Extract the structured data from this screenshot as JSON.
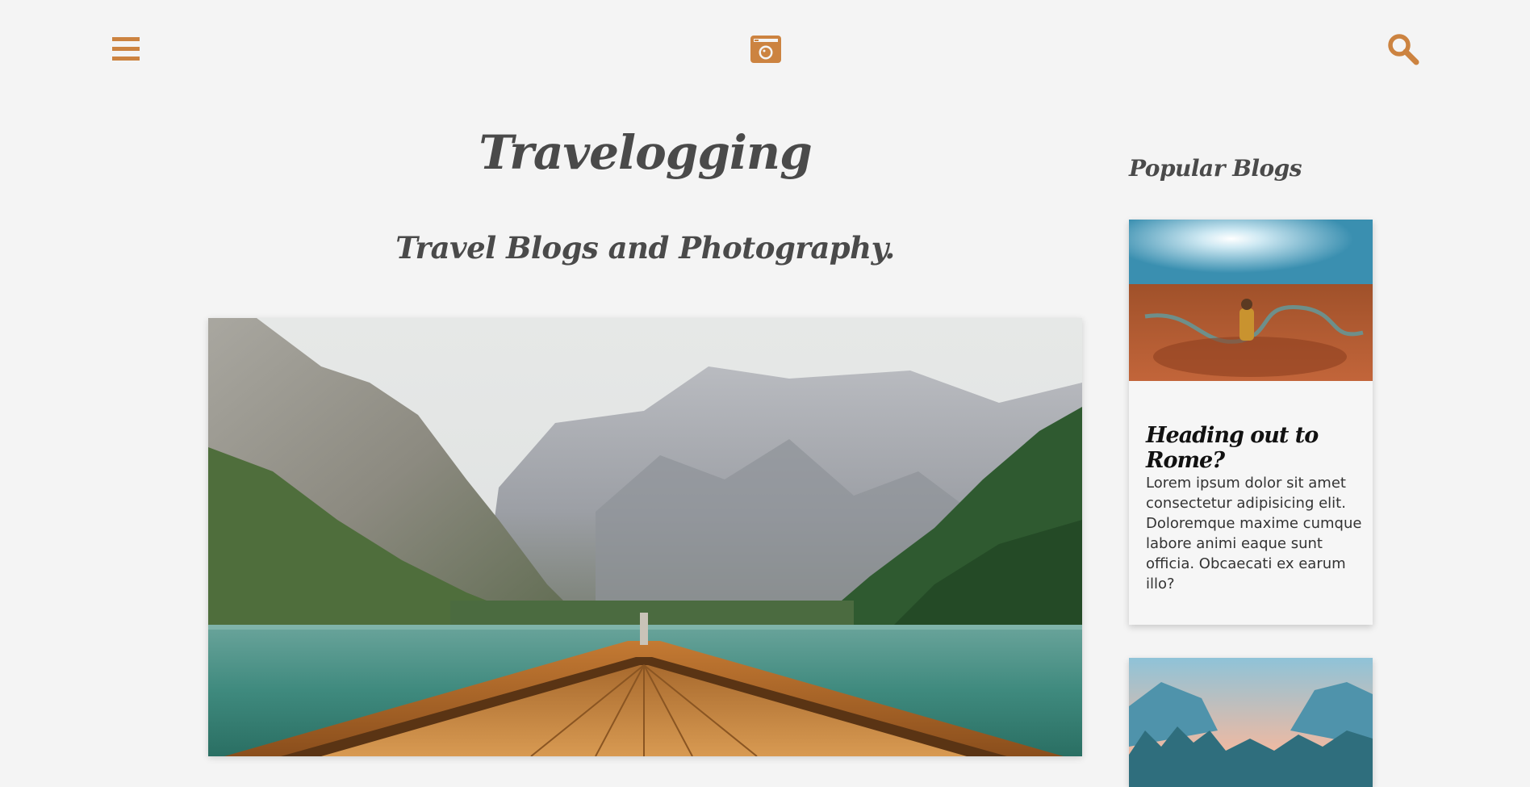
{
  "header": {
    "menu_icon": "hamburger-menu-icon",
    "logo_icon": "camera-icon",
    "search_icon": "search-icon",
    "accent_color": "#cc8340"
  },
  "main": {
    "title": "Travelogging",
    "subtitle": "Travel Blogs and Photography."
  },
  "sidebar": {
    "title": "Popular Blogs",
    "cards": [
      {
        "heading": "Heading out to Rome?",
        "text": "Lorem ipsum dolor sit amet consectetur adipisicing elit. Doloremque maxime cumque labore animi eaque sunt officia. Obcaecati ex earum illo?"
      }
    ]
  }
}
